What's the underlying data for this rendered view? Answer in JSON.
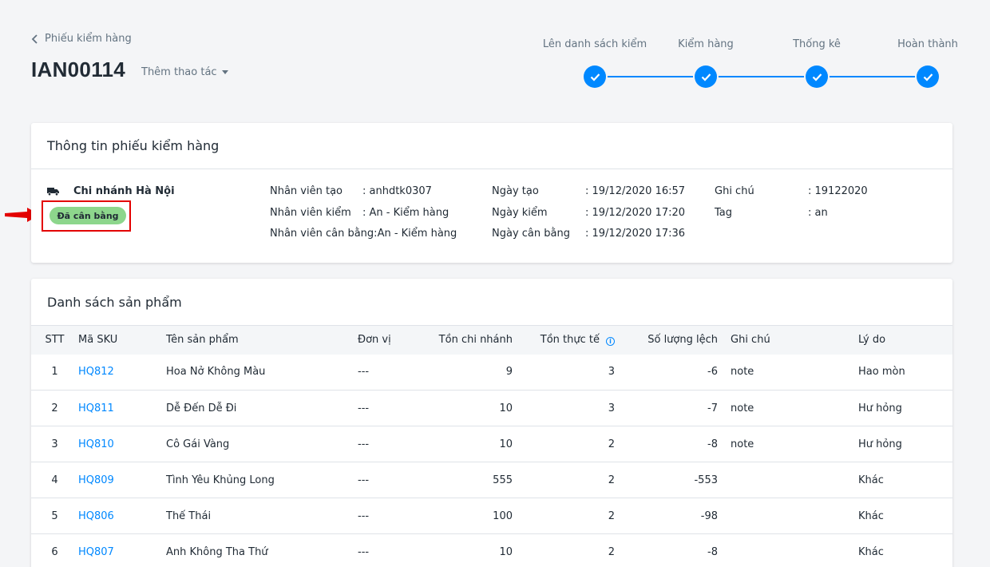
{
  "header": {
    "back_label": "Phiếu kiểm hàng",
    "title": "IAN00114",
    "more_actions": "Thêm thao tác"
  },
  "stepper": {
    "steps": [
      {
        "label": "Lên danh sách kiểm",
        "done": true
      },
      {
        "label": "Kiểm hàng",
        "done": true
      },
      {
        "label": "Thống kê",
        "done": true
      },
      {
        "label": "Hoàn thành",
        "done": true
      }
    ]
  },
  "info_card": {
    "title": "Thông tin phiếu kiểm hàng",
    "branch": "Chi nhánh Hà Nội",
    "status": "Đã cân bằng",
    "col1": [
      {
        "key": "Nhân viên tạo",
        "value": ": anhdtk0307"
      },
      {
        "key": "Nhân viên kiểm",
        "value": ": An - Kiểm hàng"
      },
      {
        "key": "Nhân viên cân bằng:",
        "value": " An - Kiểm hàng"
      }
    ],
    "col2": [
      {
        "key": "Ngày tạo",
        "value": ": 19/12/2020 16:57"
      },
      {
        "key": "Ngày kiểm",
        "value": ": 19/12/2020 17:20"
      },
      {
        "key": "Ngày cân bằng",
        "value": ": 19/12/2020 17:36"
      }
    ],
    "col3": [
      {
        "key": "Ghi chú",
        "value": ": 19122020"
      },
      {
        "key": "Tag",
        "value": ": an"
      }
    ]
  },
  "products": {
    "title": "Danh sách sản phẩm",
    "headers": {
      "stt": "STT",
      "sku": "Mã SKU",
      "name": "Tên sản phẩm",
      "unit": "Đơn vị",
      "branch_stock": "Tồn chi nhánh",
      "real_stock": "Tồn thực tế",
      "diff": "Số lượng lệch",
      "note": "Ghi chú",
      "reason": "Lý do"
    },
    "rows": [
      {
        "stt": "1",
        "sku": "HQ812",
        "name": "Hoa Nở Không Màu",
        "unit": "---",
        "branch_stock": "9",
        "real_stock": "3",
        "diff": "-6",
        "note": "note",
        "reason": "Hao mòn"
      },
      {
        "stt": "2",
        "sku": "HQ811",
        "name": "Dễ Đến Dễ Đi",
        "unit": "---",
        "branch_stock": "10",
        "real_stock": "3",
        "diff": "-7",
        "note": "note",
        "reason": "Hư hỏng"
      },
      {
        "stt": "3",
        "sku": "HQ810",
        "name": "Cô Gái Vàng",
        "unit": "---",
        "branch_stock": "10",
        "real_stock": "2",
        "diff": "-8",
        "note": "note",
        "reason": "Hư hỏng"
      },
      {
        "stt": "4",
        "sku": "HQ809",
        "name": "Tình Yêu Khủng Long",
        "unit": "---",
        "branch_stock": "555",
        "real_stock": "2",
        "diff": "-553",
        "note": "",
        "reason": "Khác"
      },
      {
        "stt": "5",
        "sku": "HQ806",
        "name": "Thế Thái",
        "unit": "---",
        "branch_stock": "100",
        "real_stock": "2",
        "diff": "-98",
        "note": "",
        "reason": "Khác"
      },
      {
        "stt": "6",
        "sku": "HQ807",
        "name": "Anh Không Tha Thứ",
        "unit": "---",
        "branch_stock": "10",
        "real_stock": "2",
        "diff": "-8",
        "note": "",
        "reason": "Khác"
      }
    ]
  },
  "colors": {
    "accent": "#0088ff",
    "status_badge": "#8dd68c",
    "highlight": "#e30000"
  }
}
